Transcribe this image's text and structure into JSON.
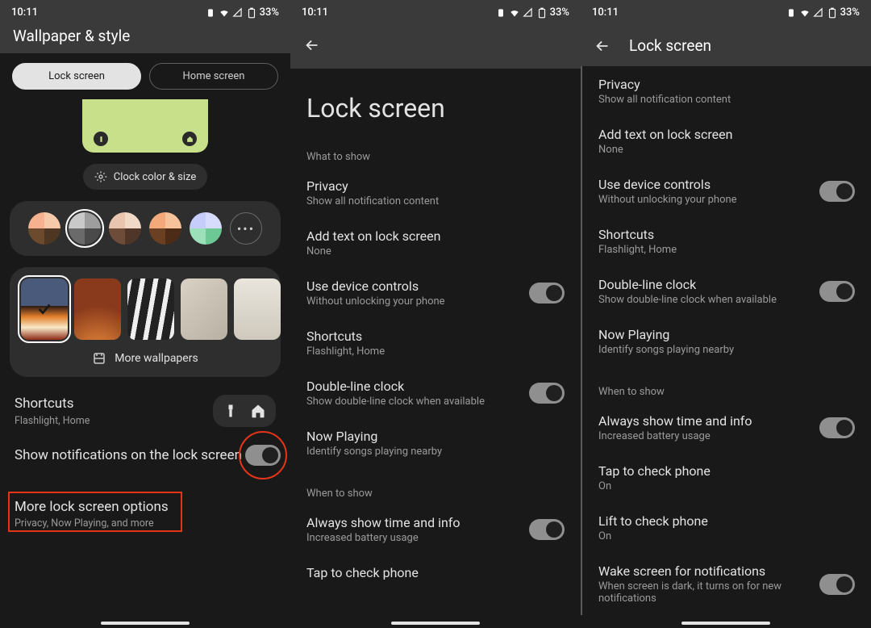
{
  "status": {
    "time": "10:11",
    "battery": "33%"
  },
  "p1": {
    "header": "Wallpaper & style",
    "tab_lock": "Lock screen",
    "tab_home": "Home screen",
    "clock_chip": "Clock color & size",
    "more_wall": "More wallpapers",
    "shortcuts_title": "Shortcuts",
    "shortcuts_sub": "Flashlight, Home",
    "notif_title": "Show notifications on the lock screen",
    "more_opts_title": "More lock screen options",
    "more_opts_sub": "Privacy, Now Playing, and more"
  },
  "p2": {
    "big_title": "Lock screen",
    "cat1": "What to show",
    "cat2": "When to show",
    "privacy_t": "Privacy",
    "privacy_s": "Show all notification content",
    "addtext_t": "Add text on lock screen",
    "addtext_s": "None",
    "devctrl_t": "Use device controls",
    "devctrl_s": "Without unlocking your phone",
    "short_t": "Shortcuts",
    "short_s": "Flashlight, Home",
    "dbl_t": "Double-line clock",
    "dbl_s": "Show double-line clock when available",
    "np_t": "Now Playing",
    "np_s": "Identify songs playing nearby",
    "always_t": "Always show time and info",
    "always_s": "Increased battery usage",
    "tap_t": "Tap to check phone"
  },
  "p3": {
    "header": "Lock screen",
    "privacy_t": "Privacy",
    "privacy_s": "Show all notification content",
    "addtext_t": "Add text on lock screen",
    "addtext_s": "None",
    "devctrl_t": "Use device controls",
    "devctrl_s": "Without unlocking your phone",
    "short_t": "Shortcuts",
    "short_s": "Flashlight, Home",
    "dbl_t": "Double-line clock",
    "dbl_s": "Show double-line clock when available",
    "np_t": "Now Playing",
    "np_s": "Identify songs playing nearby",
    "cat2": "When to show",
    "always_t": "Always show time and info",
    "always_s": "Increased battery usage",
    "tap_t": "Tap to check phone",
    "tap_s": "On",
    "lift_t": "Lift to check phone",
    "lift_s": "On",
    "wake_t": "Wake screen for notifications",
    "wake_s": "When screen is dark, it turns on for new notifications"
  }
}
